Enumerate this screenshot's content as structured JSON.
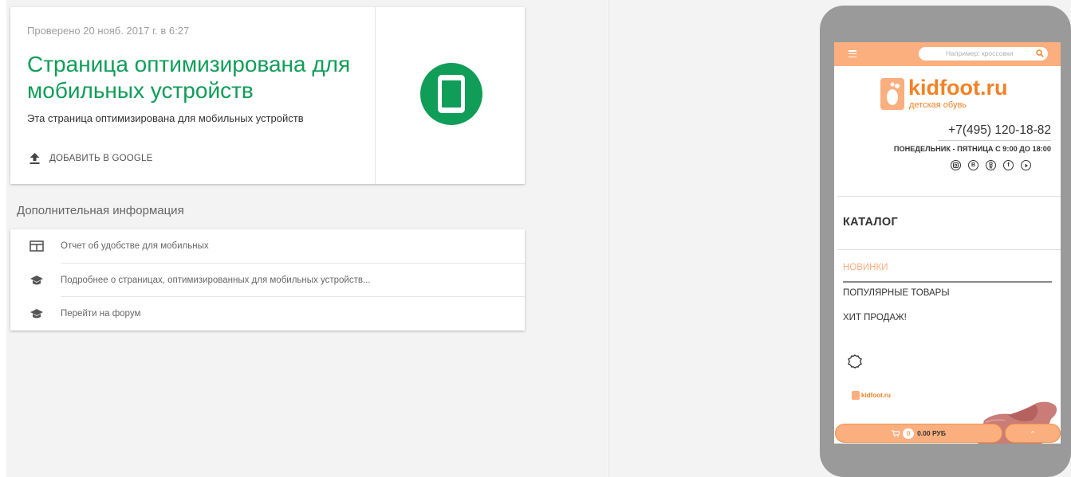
{
  "result": {
    "checked_date": "Проверено 20 нояб. 2017 г. в 6:27",
    "title": "Страница оптимизирована для мобильных устройств",
    "description": "Эта страница оптимизирована для мобильных устройств",
    "add_to_google": "ДОБАВИТЬ В GOOGLE",
    "status_color": "#0f9d58",
    "status_icon": "smartphone-icon"
  },
  "extra": {
    "heading": "Дополнительная информация",
    "items": [
      {
        "icon": "report-icon",
        "label": "Отчет об удобстве для мобильных"
      },
      {
        "icon": "graduation-cap-icon",
        "label": "Подробнее о страницах, оптимизированных для мобильных устройств..."
      },
      {
        "icon": "graduation-cap-icon",
        "label": "Перейти на форум"
      }
    ]
  },
  "preview": {
    "search_placeholder": "Например: кроссовки",
    "logo_text": "kidfoot.ru",
    "logo_subtitle": "детская обувь",
    "phone": "+7(495) 120-18-82",
    "hours": "ПОНЕДЕЛЬНИК - ПЯТНИЦА С 9:00 ДО 18:00",
    "socials": [
      "instagram-icon",
      "vk-icon",
      "odnoklassniki-icon",
      "facebook-icon",
      "youtube-icon"
    ],
    "catalog": "КАТАЛОГ",
    "menu": [
      "НОВИНКИ",
      "ПОПУЛЯРНЫЕ ТОВАРЫ",
      "ХИТ ПРОДАЖ!"
    ],
    "banner_logo": "kidfoot.ru",
    "cart_count": "0",
    "cart_total": "0.00 РУБ",
    "up_label": "^",
    "accent_color": "#fbae7e",
    "brand_color": "#f48126"
  }
}
